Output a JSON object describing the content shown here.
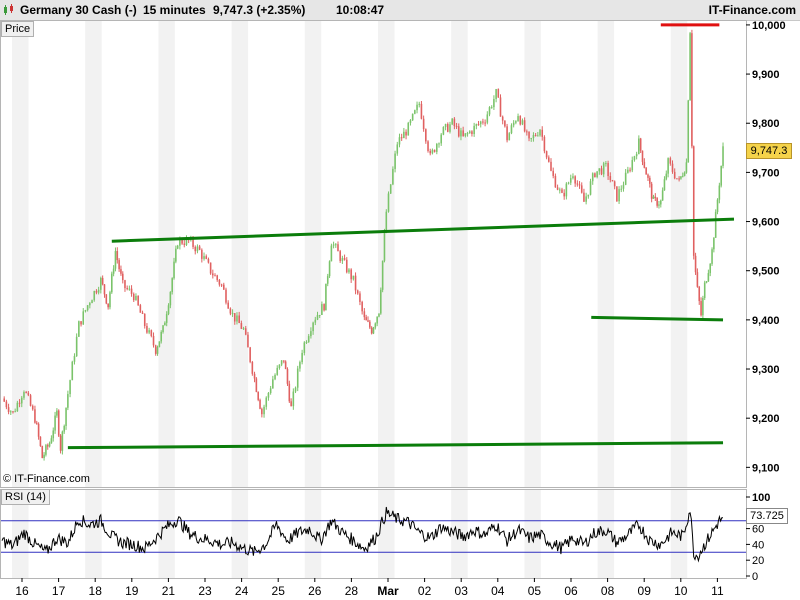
{
  "header": {
    "instrument": "Germany 30 Cash (-)",
    "interval": "15 minutes",
    "quote": "9,747.3 (+2.35%)",
    "time": "10:08:47",
    "brand": "IT-Finance.com"
  },
  "panels": {
    "price_label": "Price",
    "rsi_label": "RSI (14)",
    "copyright": "© IT-Finance.com"
  },
  "badges": {
    "last_price": "9,747.3",
    "last_rsi": "73.725"
  },
  "colors": {
    "up_candle": "#7ac36a",
    "down_candle": "#e06060",
    "trendline": "#0b7d0b",
    "resistance_line": "#e01010",
    "rsi_line": "#000000",
    "rsi_band": "#3030c0",
    "grid_stripe": "#f2f2f2"
  },
  "chart_data": [
    {
      "type": "candlestick",
      "panel": "price",
      "y_axis": {
        "ticks": [
          "9,100",
          "9,200",
          "9,300",
          "9,400",
          "9,500",
          "9,600",
          "9,700",
          "9,800",
          "9,900",
          "10,000"
        ],
        "ylim": [
          9060,
          10010
        ]
      },
      "x_axis": {
        "ticks": [
          "16",
          "17",
          "18",
          "19",
          "21",
          "23",
          "24",
          "25",
          "26",
          "28",
          "Mar",
          "02",
          "03",
          "04",
          "05",
          "06",
          "08",
          "09",
          "10",
          "11"
        ]
      },
      "x_index_range": [
        0,
        19.7
      ],
      "closes_path": [
        [
          0,
          9240
        ],
        [
          0.3,
          9210
        ],
        [
          0.6,
          9260
        ],
        [
          0.9,
          9200
        ],
        [
          1.1,
          9120
        ],
        [
          1.3,
          9150
        ],
        [
          1.5,
          9210
        ],
        [
          1.6,
          9140
        ],
        [
          1.8,
          9250
        ],
        [
          2.1,
          9390
        ],
        [
          2.4,
          9440
        ],
        [
          2.7,
          9480
        ],
        [
          2.9,
          9430
        ],
        [
          3.1,
          9540
        ],
        [
          3.3,
          9470
        ],
        [
          3.6,
          9450
        ],
        [
          3.9,
          9390
        ],
        [
          4.2,
          9340
        ],
        [
          4.4,
          9380
        ],
        [
          4.6,
          9460
        ],
        [
          4.8,
          9560
        ],
        [
          5.1,
          9560
        ],
        [
          5.4,
          9540
        ],
        [
          5.7,
          9500
        ],
        [
          6.0,
          9470
        ],
        [
          6.3,
          9410
        ],
        [
          6.6,
          9380
        ],
        [
          6.9,
          9280
        ],
        [
          7.1,
          9210
        ],
        [
          7.4,
          9280
        ],
        [
          7.7,
          9320
        ],
        [
          7.9,
          9220
        ],
        [
          8.2,
          9340
        ],
        [
          8.5,
          9400
        ],
        [
          8.8,
          9430
        ],
        [
          9.0,
          9560
        ],
        [
          9.3,
          9520
        ],
        [
          9.6,
          9480
        ],
        [
          9.9,
          9400
        ],
        [
          10.1,
          9380
        ],
        [
          10.3,
          9420
        ],
        [
          10.5,
          9620
        ],
        [
          10.8,
          9760
        ],
        [
          11.1,
          9790
        ],
        [
          11.4,
          9840
        ],
        [
          11.7,
          9730
        ],
        [
          12.0,
          9780
        ],
        [
          12.3,
          9800
        ],
        [
          12.6,
          9770
        ],
        [
          12.9,
          9790
        ],
        [
          13.2,
          9810
        ],
        [
          13.5,
          9860
        ],
        [
          13.8,
          9770
        ],
        [
          14.1,
          9820
        ],
        [
          14.4,
          9760
        ],
        [
          14.7,
          9790
        ],
        [
          15.0,
          9700
        ],
        [
          15.3,
          9650
        ],
        [
          15.6,
          9700
        ],
        [
          15.9,
          9640
        ],
        [
          16.2,
          9700
        ],
        [
          16.5,
          9710
        ],
        [
          16.8,
          9650
        ],
        [
          17.1,
          9700
        ],
        [
          17.4,
          9760
        ],
        [
          17.6,
          9700
        ],
        [
          17.8,
          9640
        ],
        [
          18.0,
          9640
        ],
        [
          18.2,
          9720
        ],
        [
          18.5,
          9680
        ],
        [
          18.7,
          9720
        ],
        [
          18.8,
          9990
        ],
        [
          18.9,
          9530
        ],
        [
          19.0,
          9460
        ],
        [
          19.1,
          9410
        ],
        [
          19.2,
          9470
        ],
        [
          19.4,
          9540
        ],
        [
          19.6,
          9680
        ],
        [
          19.7,
          9747
        ]
      ],
      "annotations": {
        "trend_lines": [
          {
            "from": [
              3.0,
              9560
            ],
            "to": [
              20.0,
              9605
            ]
          },
          {
            "from": [
              1.8,
              9140
            ],
            "to": [
              19.7,
              9150
            ]
          },
          {
            "from": [
              16.1,
              9405
            ],
            "to": [
              19.7,
              9400
            ]
          }
        ],
        "resistance_line": {
          "from": [
            18.0,
            10000
          ],
          "to": [
            19.6,
            10000
          ]
        }
      }
    },
    {
      "type": "line",
      "panel": "rsi",
      "y_axis": {
        "ticks": [
          "0",
          "20",
          "40",
          "60",
          "100"
        ],
        "ylim": [
          0,
          100
        ]
      },
      "bands": [
        30,
        70
      ],
      "closes_path": [
        [
          0,
          45
        ],
        [
          0.3,
          38
        ],
        [
          0.6,
          55
        ],
        [
          0.9,
          40
        ],
        [
          1.2,
          30
        ],
        [
          1.5,
          48
        ],
        [
          1.8,
          42
        ],
        [
          2.1,
          72
        ],
        [
          2.4,
          65
        ],
        [
          2.7,
          70
        ],
        [
          3.0,
          50
        ],
        [
          3.3,
          42
        ],
        [
          3.6,
          40
        ],
        [
          3.9,
          35
        ],
        [
          4.2,
          48
        ],
        [
          4.5,
          62
        ],
        [
          4.8,
          72
        ],
        [
          5.1,
          55
        ],
        [
          5.4,
          48
        ],
        [
          5.7,
          45
        ],
        [
          6.0,
          40
        ],
        [
          6.3,
          42
        ],
        [
          6.6,
          35
        ],
        [
          6.9,
          30
        ],
        [
          7.2,
          40
        ],
        [
          7.5,
          65
        ],
        [
          7.8,
          45
        ],
        [
          8.1,
          55
        ],
        [
          8.4,
          60
        ],
        [
          8.7,
          45
        ],
        [
          9.0,
          70
        ],
        [
          9.3,
          55
        ],
        [
          9.6,
          45
        ],
        [
          9.9,
          35
        ],
        [
          10.2,
          48
        ],
        [
          10.5,
          80
        ],
        [
          10.8,
          72
        ],
        [
          11.1,
          68
        ],
        [
          11.4,
          55
        ],
        [
          11.7,
          48
        ],
        [
          12.0,
          62
        ],
        [
          12.3,
          56
        ],
        [
          12.6,
          50
        ],
        [
          12.9,
          58
        ],
        [
          13.2,
          52
        ],
        [
          13.5,
          65
        ],
        [
          13.8,
          45
        ],
        [
          14.1,
          58
        ],
        [
          14.4,
          48
        ],
        [
          14.7,
          52
        ],
        [
          15.0,
          42
        ],
        [
          15.3,
          35
        ],
        [
          15.6,
          48
        ],
        [
          15.9,
          40
        ],
        [
          16.2,
          55
        ],
        [
          16.5,
          58
        ],
        [
          16.8,
          42
        ],
        [
          17.1,
          52
        ],
        [
          17.4,
          65
        ],
        [
          17.7,
          45
        ],
        [
          18.0,
          40
        ],
        [
          18.3,
          55
        ],
        [
          18.6,
          50
        ],
        [
          18.8,
          85
        ],
        [
          18.9,
          30
        ],
        [
          19.0,
          25
        ],
        [
          19.2,
          40
        ],
        [
          19.4,
          55
        ],
        [
          19.6,
          70
        ],
        [
          19.7,
          73.725
        ]
      ]
    }
  ]
}
